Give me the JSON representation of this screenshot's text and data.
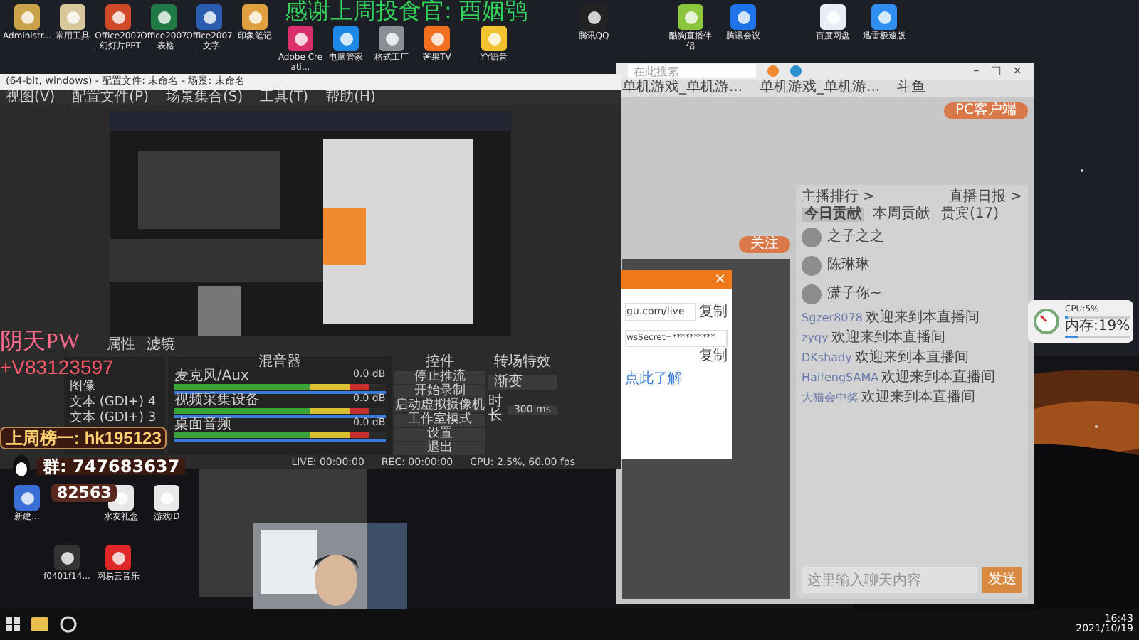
{
  "banner": "感谢上周投食官: 酉姻鸮",
  "desktop_icons": [
    {
      "label": "Administr...",
      "color": "#c9a24a"
    },
    {
      "label": "常用工具",
      "color": "#d8c79a"
    },
    {
      "label": "Office2007_幻灯片PPT",
      "color": "#d04a2a"
    },
    {
      "label": "Office2007_表格",
      "color": "#1f7a45"
    },
    {
      "label": "Office2007_文字",
      "color": "#2a5db0"
    },
    {
      "label": "印象笔记",
      "color": "#e0a040"
    },
    {
      "label": "Adobe Creati...",
      "color": "#d8306a"
    },
    {
      "label": "电脑管家",
      "color": "#1e88e5"
    },
    {
      "label": "格式工厂",
      "color": "#8a8f96"
    },
    {
      "label": "芒果TV",
      "color": "#f07020"
    },
    {
      "label": "YY语音",
      "color": "#f2c230"
    },
    {
      "label": "腾讯QQ",
      "color": "#222222"
    },
    {
      "label": "酷狗直播伴侣",
      "color": "#8cc63f"
    },
    {
      "label": "腾讯会议",
      "color": "#1e73e8"
    },
    {
      "label": "百度网盘",
      "color": "#e8eef8"
    },
    {
      "label": "迅雷极速版",
      "color": "#2e8ff0"
    },
    {
      "label": "新建...",
      "color": "#3b6fd8"
    },
    {
      "label": "水友礼盒",
      "color": "#e8e8e8"
    },
    {
      "label": "游戏ID",
      "color": "#e8e8e8"
    },
    {
      "label": "f0401f14...",
      "color": "#333333"
    },
    {
      "label": "网易云音乐",
      "color": "#e02828"
    }
  ],
  "obs": {
    "title": "(64-bit, windows) - 配置文件: 未命名 - 场景: 未命名",
    "menu": [
      "视图(V)",
      "配置文件(P)",
      "场景集合(S)",
      "工具(T)",
      "帮助(H)"
    ],
    "toolbar": [
      "属性",
      "滤镜"
    ],
    "sources": [
      {
        "name": "图像"
      },
      {
        "name": "文本 (GDI+) 4"
      },
      {
        "name": "文本 (GDI+) 3"
      }
    ],
    "mixer_title": "混音器",
    "channels": [
      {
        "name": "麦克风/Aux",
        "reading": "0.0 dB",
        "level": 0.92
      },
      {
        "name": "视频采集设备",
        "reading": "0.0 dB",
        "level": 0.92
      },
      {
        "name": "桌面音频",
        "reading": "0.0 dB",
        "level": 0.92
      }
    ],
    "controls_title": "控件",
    "controls": [
      "停止推流",
      "开始录制",
      "启动虚拟摄像机",
      "工作室模式",
      "设置",
      "退出"
    ],
    "transitions_title": "转场特效",
    "transition": "渐变",
    "duration_label": "时长",
    "duration": "300 ms",
    "status": [
      "LIVE: 00:00:00",
      "REC: 00:00:00",
      "CPU: 2.5%, 60.00 fps"
    ]
  },
  "overlay": {
    "name": "阴天PW",
    "contact": "+V83123597",
    "top_fan": "上周榜一: hk195123",
    "group": "群: 747683637",
    "count": "82563"
  },
  "browser": {
    "window_buttons": [
      "–",
      "□",
      "×"
    ],
    "search_placeholder": "在此搜索",
    "bookmarks": [
      "单机游戏_单机游...",
      "单机游戏_单机游...",
      "斗鱼"
    ],
    "client_button": "PC客户端",
    "follow_button": "关注",
    "chat_links": [
      "主播排行 >",
      "直播日报 >"
    ],
    "chat_tabs": [
      {
        "label": "今日贡献",
        "selected": true
      },
      {
        "label": "本周贡献",
        "selected": false
      },
      {
        "label": "贵宾(17)",
        "selected": false
      }
    ],
    "ranking": [
      {
        "name": "之子之之"
      },
      {
        "name": "陈琳琳"
      },
      {
        "name": "潇子你~"
      }
    ],
    "chat": [
      {
        "user": "Sgzer8078",
        "text": "欢迎来到本直播间"
      },
      {
        "user": "zyqy",
        "text": "欢迎来到本直播间"
      },
      {
        "user": "DKshady",
        "text": "欢迎来到本直播间"
      },
      {
        "user": "HaifengSAMA",
        "text": "欢迎来到本直播间"
      },
      {
        "user": "大猫会中奖",
        "text": "欢迎来到本直播间"
      }
    ],
    "chat_placeholder": "这里输入聊天内容",
    "send": "发送"
  },
  "dialog": {
    "close": "×",
    "url": "gu.com/live",
    "key": "wsSecret=**********",
    "copy": [
      "复制",
      "复制"
    ],
    "link": "点此了解"
  },
  "monitor": {
    "cpu": {
      "text": "CPU:5%",
      "level": 0.05
    },
    "memory": {
      "text": "内存:19%",
      "level": 0.19
    }
  },
  "clock": {
    "time": "16:43",
    "date": "2021/10/19"
  }
}
